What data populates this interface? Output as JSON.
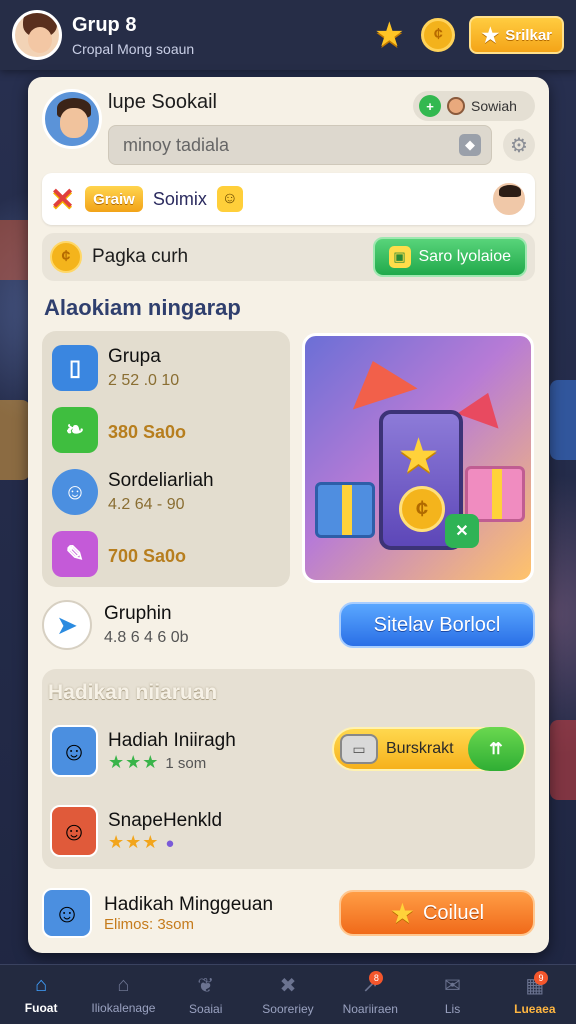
{
  "header": {
    "title": "Grup 8",
    "subtitle": "Cropal Mong soaun",
    "cta_label": "Srilkar"
  },
  "profile": {
    "name": "lupe Sookail",
    "search_text": "minoy tadiala",
    "mini_label": "Sowiah"
  },
  "promo": {
    "tag": "Graiw",
    "text": "Soimix"
  },
  "pack": {
    "label": "Pagka curh",
    "button": "Saro lyolaioe"
  },
  "section1_title": "Alaokiam ningarap",
  "list": [
    {
      "name": "Grupa",
      "value": "2 52 .0 10"
    },
    {
      "name": "",
      "value": "380 Sa0o"
    },
    {
      "name": "Sordeliarliah",
      "value": "4.2 64 - 90"
    },
    {
      "name": "",
      "value": "700 Sa0o"
    }
  ],
  "gruphin": {
    "name": "Gruphin",
    "value": "4.8 6 4 6 0b",
    "button": "Sitelav Borlocl"
  },
  "section2_title": "Hadikan niiaruan",
  "rewards": [
    {
      "name": "Hadiah Iniiragh",
      "meta": "1 som"
    },
    {
      "name": "SnapeHenkld",
      "meta": ""
    }
  ],
  "buy": {
    "label": "Burskrakt"
  },
  "bottom": {
    "name": "Hadikah Minggeuan",
    "meta": "Elimos: 3som",
    "button": "Coiluel"
  },
  "nav": [
    {
      "label": "Fuoat",
      "icon": "home-icon"
    },
    {
      "label": "Iliokalenage",
      "icon": "house-icon"
    },
    {
      "label": "Soaiai",
      "icon": "leaf-icon"
    },
    {
      "label": "Sooreriey",
      "icon": "tools-icon"
    },
    {
      "label": "Noariiraen",
      "icon": "chart-icon",
      "badge": "8"
    },
    {
      "label": "Lis",
      "icon": "chat-icon"
    },
    {
      "label": "Lueaea",
      "icon": "gift-icon",
      "badge": "9"
    }
  ]
}
